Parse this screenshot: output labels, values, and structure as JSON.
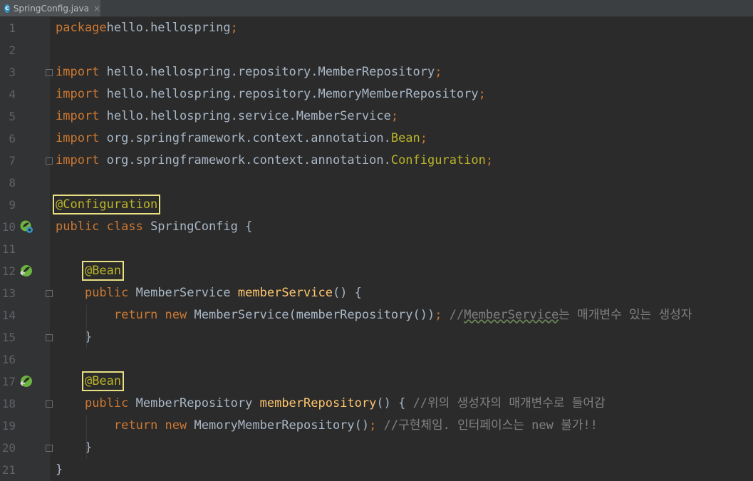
{
  "tab": {
    "filename": "SpringConfig.java",
    "icon": "class-file-icon"
  },
  "lines": [
    {
      "n": "1",
      "parts": [
        [
          "kw",
          "package"
        ],
        [
          "",
          "hello.hellospring"
        ],
        [
          "kw",
          ";"
        ]
      ]
    },
    {
      "n": "2",
      "parts": []
    },
    {
      "n": "3",
      "parts": [
        [
          "kw",
          "import"
        ],
        [
          "",
          " hello.hellospring.repository.MemberRepository"
        ],
        [
          "kw",
          ";"
        ]
      ]
    },
    {
      "n": "4",
      "parts": [
        [
          "kw",
          "import"
        ],
        [
          "",
          " hello.hellospring.repository.MemoryMemberRepository"
        ],
        [
          "kw",
          ";"
        ]
      ]
    },
    {
      "n": "5",
      "parts": [
        [
          "kw",
          "import"
        ],
        [
          "",
          " hello.hellospring.service.MemberService"
        ],
        [
          "kw",
          ";"
        ]
      ]
    },
    {
      "n": "6",
      "parts": [
        [
          "kw",
          "import"
        ],
        [
          "",
          " org.springframework.context.annotation."
        ],
        [
          "ann",
          "Bean"
        ],
        [
          "kw",
          ";"
        ]
      ]
    },
    {
      "n": "7",
      "parts": [
        [
          "kw",
          "import"
        ],
        [
          "",
          " org.springframework.context.annotation."
        ],
        [
          "ann",
          "Configuration"
        ],
        [
          "kw",
          ";"
        ]
      ]
    },
    {
      "n": "8",
      "parts": []
    },
    {
      "n": "9",
      "parts": [
        [
          "ann hl",
          "@Configuration"
        ]
      ]
    },
    {
      "n": "10",
      "parts": [
        [
          "kw",
          "public class "
        ],
        [
          "",
          "SpringConfig {"
        ]
      ]
    },
    {
      "n": "11",
      "parts": []
    },
    {
      "n": "12",
      "parts": [
        [
          "",
          "    "
        ],
        [
          "ann hl",
          "@Bean"
        ]
      ]
    },
    {
      "n": "13",
      "parts": [
        [
          "",
          "    "
        ],
        [
          "kw",
          "public "
        ],
        [
          "",
          "MemberService "
        ],
        [
          "fn",
          "memberService"
        ],
        [
          "",
          "() {"
        ]
      ]
    },
    {
      "n": "14",
      "parts": [
        [
          "",
          "        "
        ],
        [
          "kw",
          "return new "
        ],
        [
          "",
          "MemberService(memberRepository())"
        ],
        [
          "kw",
          "; "
        ],
        [
          "cm",
          "//"
        ],
        [
          "cm warn",
          "MemberService"
        ],
        [
          "cm",
          "는 매개변수 있는 생성자"
        ]
      ]
    },
    {
      "n": "15",
      "parts": [
        [
          "",
          "    }"
        ]
      ]
    },
    {
      "n": "16",
      "parts": []
    },
    {
      "n": "17",
      "parts": [
        [
          "",
          "    "
        ],
        [
          "ann hl",
          "@Bean"
        ]
      ]
    },
    {
      "n": "18",
      "parts": [
        [
          "",
          "    "
        ],
        [
          "kw",
          "public "
        ],
        [
          "",
          "MemberRepository "
        ],
        [
          "fn",
          "memberRepository"
        ],
        [
          "",
          "() { "
        ],
        [
          "cm",
          "//위의 생성자의 매개변수로 들어감"
        ]
      ]
    },
    {
      "n": "19",
      "parts": [
        [
          "",
          "        "
        ],
        [
          "kw",
          "return new "
        ],
        [
          "",
          "MemoryMemberRepository()"
        ],
        [
          "kw",
          "; "
        ],
        [
          "cm",
          "//구현체임. 인터페이스는 new 불가!!"
        ]
      ]
    },
    {
      "n": "20",
      "parts": [
        [
          "",
          "    }"
        ]
      ]
    },
    {
      "n": "21",
      "parts": [
        [
          "",
          "}"
        ]
      ]
    }
  ],
  "gutter_icons": [
    {
      "line": "10",
      "icon": "spring-config-icon"
    },
    {
      "line": "12",
      "icon": "spring-bean-icon"
    },
    {
      "line": "17",
      "icon": "spring-bean-icon"
    }
  ],
  "fold_markers": [
    "3",
    "7",
    "13",
    "15",
    "18",
    "20"
  ],
  "colors": {
    "keyword": "#cc7832",
    "annotation": "#bbb529",
    "method": "#ffc66d",
    "comment": "#808080",
    "text": "#a9b7c6",
    "highlight": "#e8e082"
  }
}
